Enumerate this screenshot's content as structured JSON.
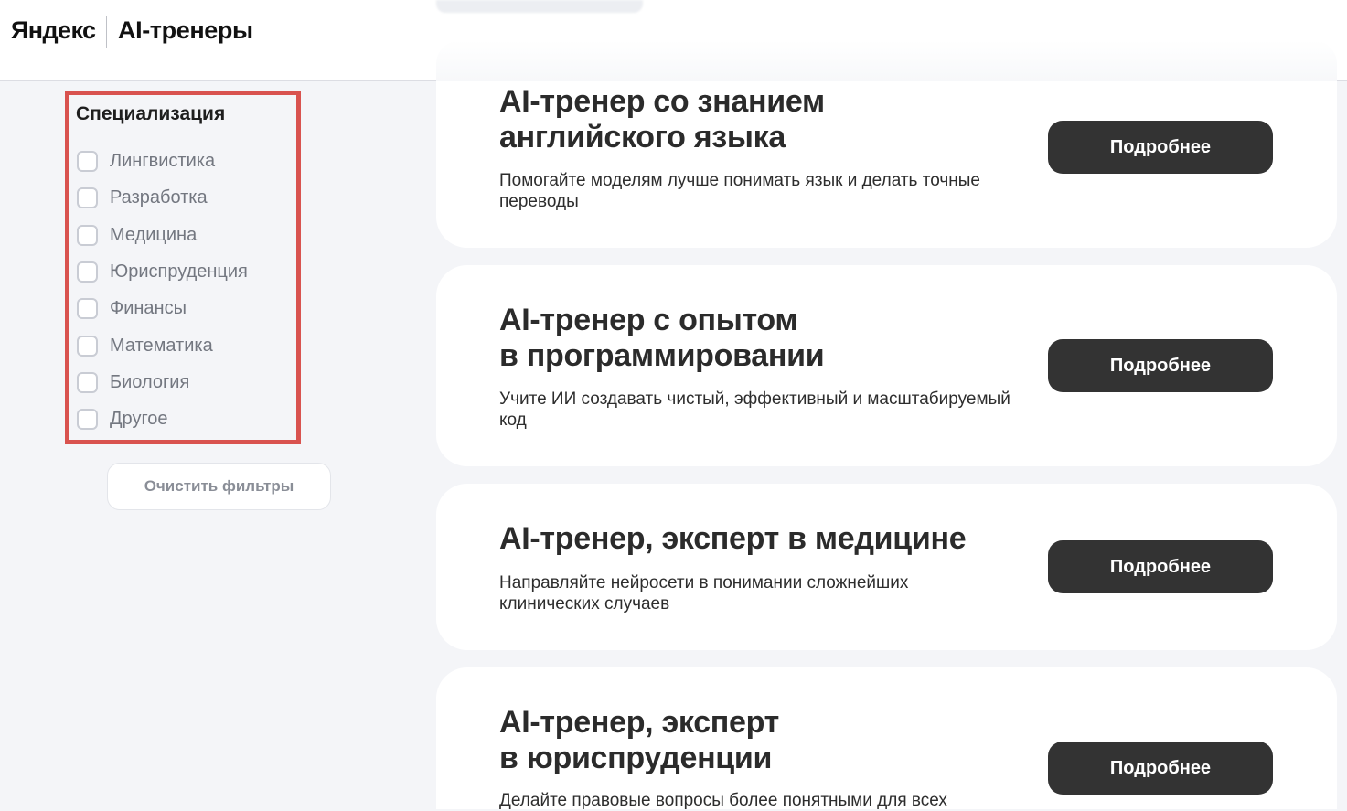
{
  "header": {
    "brand": "Яндекс",
    "product": "AI-тренеры"
  },
  "filters": {
    "title": "Специализация",
    "options": [
      {
        "label": "Лингвистика",
        "checked": false
      },
      {
        "label": "Разработка",
        "checked": false
      },
      {
        "label": "Медицина",
        "checked": false
      },
      {
        "label": "Юриспруденция",
        "checked": false
      },
      {
        "label": "Финансы",
        "checked": false
      },
      {
        "label": "Математика",
        "checked": false
      },
      {
        "label": "Биология",
        "checked": false
      },
      {
        "label": "Другое",
        "checked": false
      }
    ],
    "clear_label": "Очистить фильтры"
  },
  "cards": [
    {
      "title_lines": [
        "AI-тренер со знанием",
        "английского языка"
      ],
      "description_lines": [
        "Помогайте моделям лучше понимать язык и делать точные",
        "переводы"
      ],
      "button": "Подробнее"
    },
    {
      "title_lines": [
        "AI-тренер с опытом",
        "в программировании"
      ],
      "description_lines": [
        "Учите ИИ создавать чистый, эффективный и масштабируемый",
        "код"
      ],
      "button": "Подробнее"
    },
    {
      "title_lines": [
        "AI-тренер, эксперт в медицине"
      ],
      "description_lines": [
        "Направляйте нейросети в понимании сложнейших",
        "клинических случаев"
      ],
      "button": "Подробнее"
    },
    {
      "title_lines": [
        "AI-тренер, эксперт",
        "в юриспруденции"
      ],
      "description_lines": [
        "Делайте правовые вопросы более понятными для всех"
      ],
      "button": "Подробнее"
    }
  ],
  "colors": {
    "highlight_border": "#d9534f",
    "button_bg": "#333333",
    "page_bg": "#f4f5f8"
  }
}
